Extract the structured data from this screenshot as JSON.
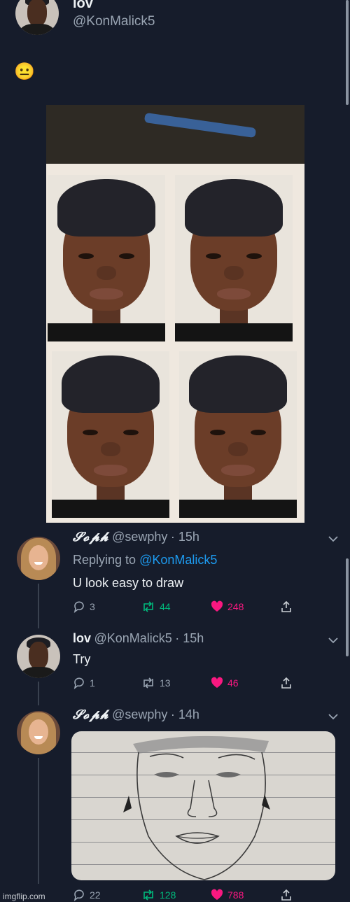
{
  "main_tweet": {
    "name": "lov",
    "handle": "@KonMalick5",
    "emoji": "😐",
    "media_icon": "passport-photos-image"
  },
  "replies": [
    {
      "name": "𝓢𝓸𝓹𝓱",
      "handle": "@sewphy",
      "time": "· 15h",
      "replying_label": "Replying to",
      "replying_handle": "@KonMalick5",
      "text": "U look easy to draw",
      "replies": "3",
      "retweets": "44",
      "likes": "248"
    },
    {
      "name": "lov",
      "handle": "@KonMalick5",
      "time": "· 15h",
      "text": "Try",
      "replies": "1",
      "retweets": "13",
      "likes": "46"
    },
    {
      "name": "𝓢𝓸𝓹𝓱",
      "handle": "@sewphy",
      "time": "· 14h",
      "media_icon": "pencil-sketch-image",
      "replies": "22",
      "retweets": "128",
      "likes": "788"
    }
  ],
  "watermark": "imgflip.com",
  "colors": {
    "background": "#161c2b",
    "link": "#1d9bf0",
    "retweet": "#00ba7c",
    "like": "#f91880",
    "muted": "#9aa5b3"
  }
}
